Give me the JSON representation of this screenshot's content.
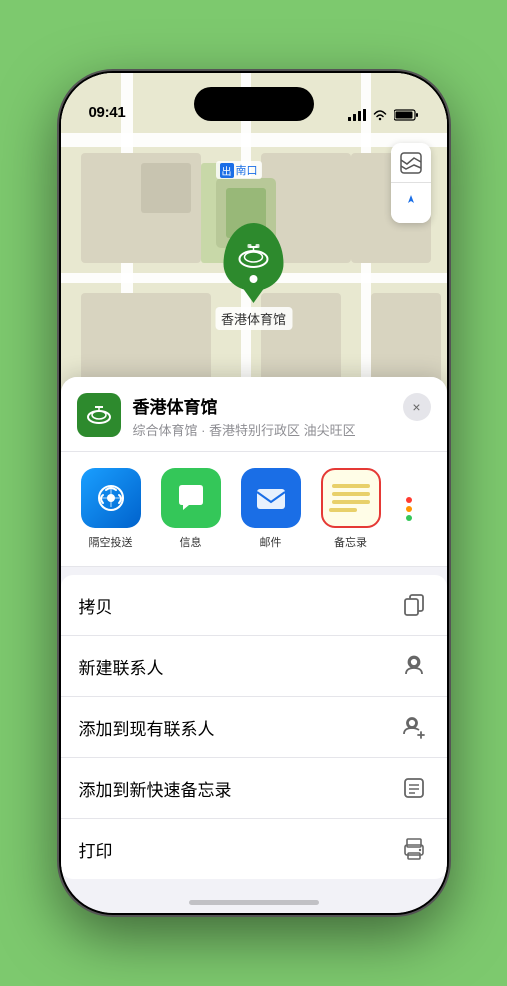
{
  "status_bar": {
    "time": "09:41",
    "signal_bars": "▌▌▌",
    "wifi": "wifi",
    "battery": "battery"
  },
  "map": {
    "south_exit_label": "南口",
    "south_exit_prefix": "出"
  },
  "map_controls": {
    "map_type_icon": "🗺",
    "location_icon": "➤"
  },
  "venue": {
    "name": "香港体育馆",
    "description": "综合体育馆 · 香港特别行政区 油尖旺区",
    "pin_label": "香港体育馆"
  },
  "apps": [
    {
      "id": "airdrop",
      "label": "隔空投送",
      "icon_type": "airdrop"
    },
    {
      "id": "messages",
      "label": "信息",
      "icon_type": "messages"
    },
    {
      "id": "mail",
      "label": "邮件",
      "icon_type": "mail"
    },
    {
      "id": "notes",
      "label": "备忘录",
      "icon_type": "notes"
    }
  ],
  "more_dots_colors": [
    "#ff3b30",
    "#ff9500",
    "#34c759"
  ],
  "actions": [
    {
      "id": "copy",
      "label": "拷贝",
      "icon": "⧉"
    },
    {
      "id": "new-contact",
      "label": "新建联系人",
      "icon": "👤"
    },
    {
      "id": "add-contact",
      "label": "添加到现有联系人",
      "icon": "➕"
    },
    {
      "id": "add-note",
      "label": "添加到新快速备忘录",
      "icon": "📋"
    },
    {
      "id": "print",
      "label": "打印",
      "icon": "🖨"
    }
  ],
  "close_btn_label": "×"
}
